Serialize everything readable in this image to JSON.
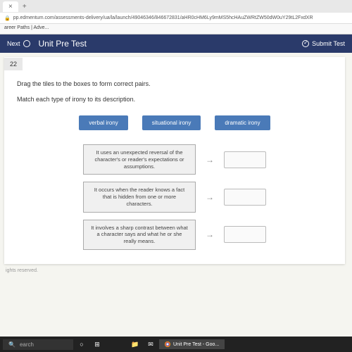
{
  "browser": {
    "tab_close": "×",
    "tab_add": "+",
    "url": "pp.edmentum.com/assessments-delivery/ua/la/launch/49046346/846672831/aHR0cHM6Ly9mMS5hcHAuZWRtZW50dW0uY29tL2FxdXR",
    "bookmark": "areer Paths | Adve..."
  },
  "header": {
    "next": "Next",
    "title": "Unit Pre Test",
    "submit": "Submit Test"
  },
  "question": {
    "number": "22",
    "instruction": "Drag the tiles to the boxes to form correct pairs.",
    "prompt": "Match each type of irony to its description."
  },
  "tiles": [
    "verbal irony",
    "situational irony",
    "dramatic irony"
  ],
  "descriptions": [
    "It uses an unexpected reversal of the character's or reader's expectations or assumptions.",
    "It occurs when the reader knows a fact that is hidden from one or more characters.",
    "It involves a sharp contrast between what a character says and what he or she really means."
  ],
  "footer": "ights reserved.",
  "taskbar": {
    "search": "earch",
    "active_window": "Unit Pre Test - Goo..."
  }
}
